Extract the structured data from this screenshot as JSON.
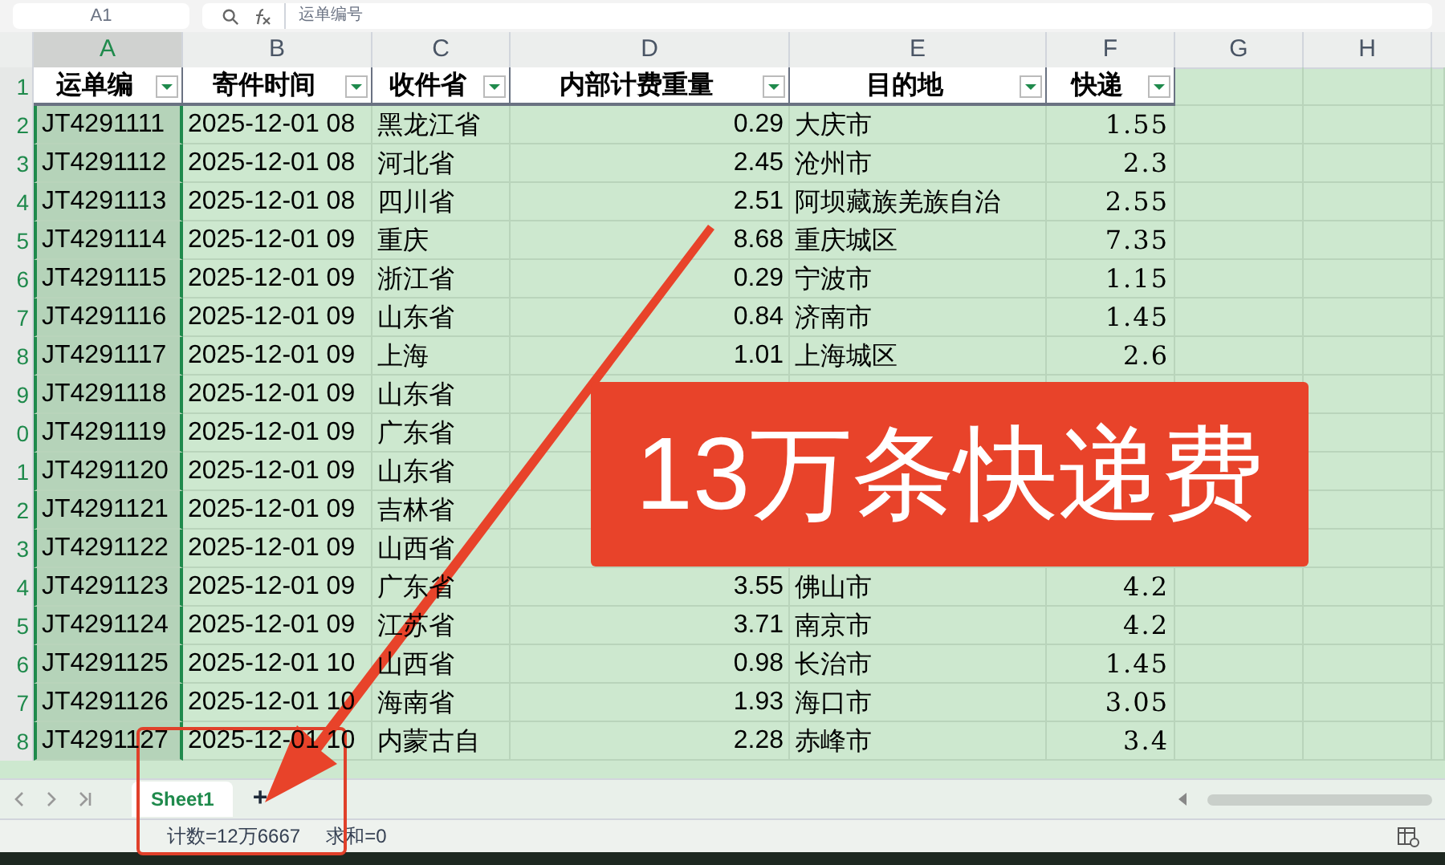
{
  "name_box": "A1",
  "formula": "运单编号",
  "columns": [
    {
      "letter": "A",
      "selected": true
    },
    {
      "letter": "B",
      "selected": false
    },
    {
      "letter": "C",
      "selected": false
    },
    {
      "letter": "D",
      "selected": false
    },
    {
      "letter": "E",
      "selected": false
    },
    {
      "letter": "F",
      "selected": false
    },
    {
      "letter": "G",
      "selected": false
    },
    {
      "letter": "H",
      "selected": false
    }
  ],
  "header_row": {
    "number": "1",
    "cells": [
      "运单编",
      "寄件时间",
      "收件省",
      "内部计费重量",
      "目的地",
      "快递"
    ]
  },
  "rows": [
    {
      "number": "2",
      "cells": [
        "JT4291111",
        "2025-12-01 08",
        "黑龙江省",
        "0.29",
        "大庆市",
        "1.55"
      ]
    },
    {
      "number": "3",
      "cells": [
        "JT4291112",
        "2025-12-01 08",
        "河北省",
        "2.45",
        "沧州市",
        "2.3"
      ]
    },
    {
      "number": "4",
      "cells": [
        "JT4291113",
        "2025-12-01 08",
        "四川省",
        "2.51",
        "阿坝藏族羌族自治",
        "2.55"
      ]
    },
    {
      "number": "5",
      "cells": [
        "JT4291114",
        "2025-12-01 09",
        "重庆",
        "8.68",
        "重庆城区",
        "7.35"
      ]
    },
    {
      "number": "6",
      "cells": [
        "JT4291115",
        "2025-12-01 09",
        "浙江省",
        "0.29",
        "宁波市",
        "1.15"
      ]
    },
    {
      "number": "7",
      "cells": [
        "JT4291116",
        "2025-12-01 09",
        "山东省",
        "0.84",
        "济南市",
        "1.45"
      ]
    },
    {
      "number": "8",
      "cells": [
        "JT4291117",
        "2025-12-01 09",
        "上海",
        "1.01",
        "上海城区",
        "2.6"
      ]
    },
    {
      "number": "9",
      "cells": [
        "JT4291118",
        "2025-12-01 09",
        "山东省"
      ]
    },
    {
      "number": "0",
      "cells": [
        "JT4291119",
        "2025-12-01 09",
        "广东省"
      ]
    },
    {
      "number": "1",
      "cells": [
        "JT4291120",
        "2025-12-01 09",
        "山东省"
      ]
    },
    {
      "number": "2",
      "cells": [
        "JT4291121",
        "2025-12-01 09",
        "吉林省"
      ]
    },
    {
      "number": "3",
      "cells": [
        "JT4291122",
        "2025-12-01 09",
        "山西省"
      ]
    },
    {
      "number": "4",
      "cells": [
        "JT4291123",
        "2025-12-01 09",
        "广东省",
        "3.55",
        "佛山市",
        "4.2"
      ]
    },
    {
      "number": "5",
      "cells": [
        "JT4291124",
        "2025-12-01 09",
        "江苏省",
        "3.71",
        "南京市",
        "4.2"
      ]
    },
    {
      "number": "6",
      "cells": [
        "JT4291125",
        "2025-12-01 10",
        "山西省",
        "0.98",
        "长治市",
        "1.45"
      ]
    },
    {
      "number": "7",
      "cells": [
        "JT4291126",
        "2025-12-01 10",
        "海南省",
        "1.93",
        "海口市",
        "3.05"
      ]
    },
    {
      "number": "8",
      "cells": [
        "JT4291127",
        "2025-12-01 10",
        "内蒙古自",
        "2.28",
        "赤峰市",
        "3.4"
      ]
    }
  ],
  "sheet_tabs": [
    {
      "label": "Sheet1",
      "selected": true
    }
  ],
  "add_sheet": "+",
  "status": [
    "计数=12万6667",
    "求和=0"
  ],
  "banner": "13万条快递费"
}
